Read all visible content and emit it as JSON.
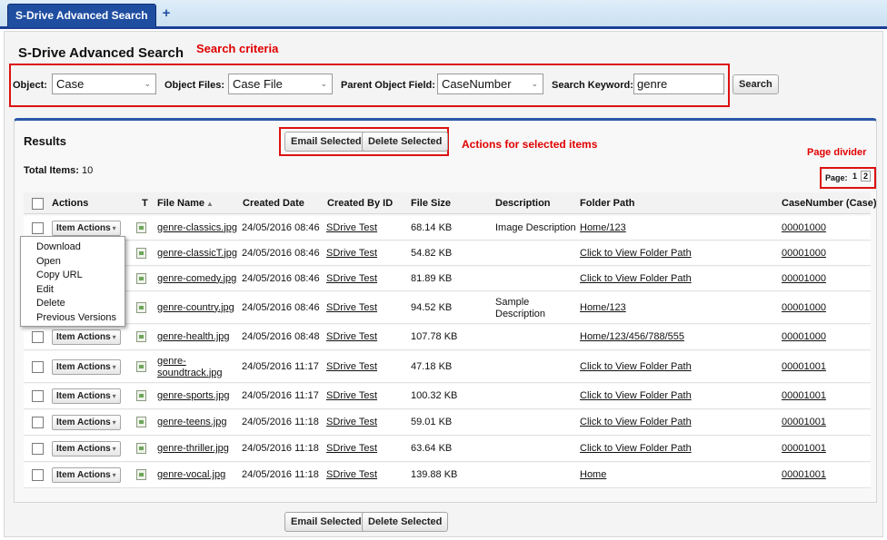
{
  "tabs": {
    "active": "S-Drive Advanced Search",
    "add": "+"
  },
  "page_title": "S-Drive Advanced Search",
  "annotations": {
    "search_criteria": "Search criteria",
    "actions_selected": "Actions for selected items",
    "page_divider": "Page divider"
  },
  "criteria": {
    "object_label": "Object:",
    "object_value": "Case",
    "object_files_label": "Object Files:",
    "object_files_value": "Case File",
    "parent_field_label": "Parent Object Field:",
    "parent_field_value": "CaseNumber",
    "keyword_label": "Search Keyword:",
    "keyword_value": "genre",
    "search_button": "Search"
  },
  "results": {
    "title": "Results",
    "email_selected": "Email Selected",
    "delete_selected": "Delete Selected",
    "total_label": "Total Items:",
    "total_value": "10",
    "page_label": "Page:",
    "page_current": "1",
    "page_next": "2"
  },
  "columns": {
    "actions": "Actions",
    "type": "T",
    "file_name": "File Name",
    "created_date": "Created Date",
    "created_by": "Created By ID",
    "file_size": "File Size",
    "description": "Description",
    "folder_path": "Folder Path",
    "case_number": "CaseNumber (Case)"
  },
  "item_actions_label": "Item Actions",
  "menu": [
    "Download",
    "Open",
    "Copy URL",
    "Edit",
    "Delete",
    "Previous Versions"
  ],
  "rows": [
    {
      "file": "genre-classics.jpg",
      "date": "24/05/2016 08:46",
      "by": "SDrive Test",
      "size": "68.14 KB",
      "desc": "Image Description",
      "path": "Home/123",
      "case": "00001000"
    },
    {
      "file": "genre-classicT.jpg",
      "date": "24/05/2016 08:46",
      "by": "SDrive Test",
      "size": "54.82 KB",
      "desc": "",
      "path": "Click to View Folder Path",
      "case": "00001000"
    },
    {
      "file": "genre-comedy.jpg",
      "date": "24/05/2016 08:46",
      "by": "SDrive Test",
      "size": "81.89 KB",
      "desc": "",
      "path": "Click to View Folder Path",
      "case": "00001000"
    },
    {
      "file": "genre-country.jpg",
      "date": "24/05/2016 08:46",
      "by": "SDrive Test",
      "size": "94.52 KB",
      "desc": "Sample Description",
      "path": "Home/123",
      "case": "00001000"
    },
    {
      "file": "genre-health.jpg",
      "date": "24/05/2016 08:48",
      "by": "SDrive Test",
      "size": "107.78 KB",
      "desc": "",
      "path": "Home/123/456/788/555",
      "case": "00001000"
    },
    {
      "file": "genre-soundtrack.jpg",
      "date": "24/05/2016 11:17",
      "by": "SDrive Test",
      "size": "47.18 KB",
      "desc": "",
      "path": "Click to View Folder Path",
      "case": "00001001"
    },
    {
      "file": "genre-sports.jpg",
      "date": "24/05/2016 11:17",
      "by": "SDrive Test",
      "size": "100.32 KB",
      "desc": "",
      "path": "Click to View Folder Path",
      "case": "00001001"
    },
    {
      "file": "genre-teens.jpg",
      "date": "24/05/2016 11:18",
      "by": "SDrive Test",
      "size": "59.01 KB",
      "desc": "",
      "path": "Click to View Folder Path",
      "case": "00001001"
    },
    {
      "file": "genre-thriller.jpg",
      "date": "24/05/2016 11:18",
      "by": "SDrive Test",
      "size": "63.64 KB",
      "desc": "",
      "path": "Click to View Folder Path",
      "case": "00001001"
    },
    {
      "file": "genre-vocal.jpg",
      "date": "24/05/2016 11:18",
      "by": "SDrive Test",
      "size": "139.88 KB",
      "desc": "",
      "path": "Home",
      "case": "00001001"
    }
  ]
}
